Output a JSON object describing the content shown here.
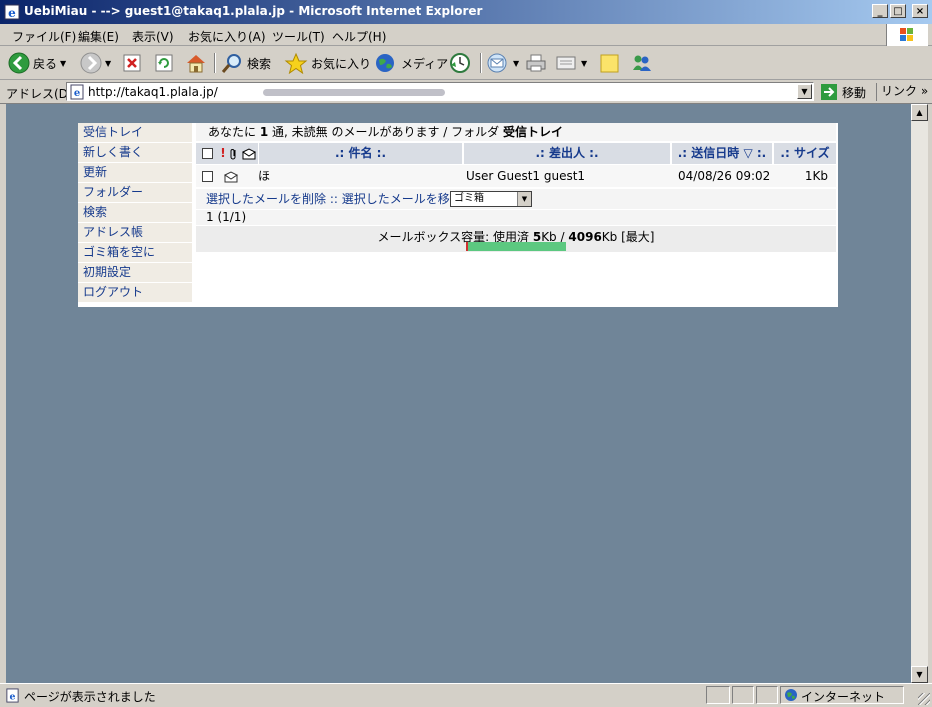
{
  "window": {
    "title": "UebiMiau - --> guest1@takaq1.plala.jp - Microsoft Internet Explorer"
  },
  "menu": [
    "ファイル(F)",
    "編集(E)",
    "表示(V)",
    "お気に入り(A)",
    "ツール(T)",
    "ヘルプ(H)"
  ],
  "toolbar": {
    "back": "戻る",
    "search": "検索",
    "favorites": "お気に入り",
    "media": "メディア"
  },
  "address": {
    "label": "アドレス(D)",
    "url": "http://takaq1.plala.jp/",
    "go": "移動",
    "links": "リンク"
  },
  "sidebar": [
    "受信トレイ",
    "新しく書く",
    "更新",
    "フォルダー",
    "検索",
    "アドレス帳",
    "ゴミ箱を空に",
    "初期設定",
    "ログアウト"
  ],
  "summary": {
    "prefix": "あなたに",
    "count": "1",
    "middle": "通, 未読無 のメールがあります / フォルダ",
    "folder": "受信トレイ"
  },
  "columns": {
    "subject": ".: 件名 :.",
    "from": ".: 差出人 :.",
    "date": ".: 送信日時 ▽ :.",
    "size": ".: サイズ :."
  },
  "messages": [
    {
      "subject": "ほ",
      "from": "User Guest1 guest1",
      "date": "04/08/26 09:02",
      "size": "1Kb"
    }
  ],
  "actions": {
    "delete": "選択したメールを削除",
    "separator": "::",
    "move": "選択したメールを移動",
    "target": "ゴミ箱"
  },
  "pager": "1 (1/1)",
  "quota": {
    "label": "メールボックス容量: 使用済",
    "used": "5",
    "unit": "Kb",
    "slash": "/",
    "total": "4096",
    "max": "[最大]",
    "fill_fraction": 0.001
  },
  "statusbar": {
    "message": "ページが表示されました",
    "zone": "インターネット"
  }
}
